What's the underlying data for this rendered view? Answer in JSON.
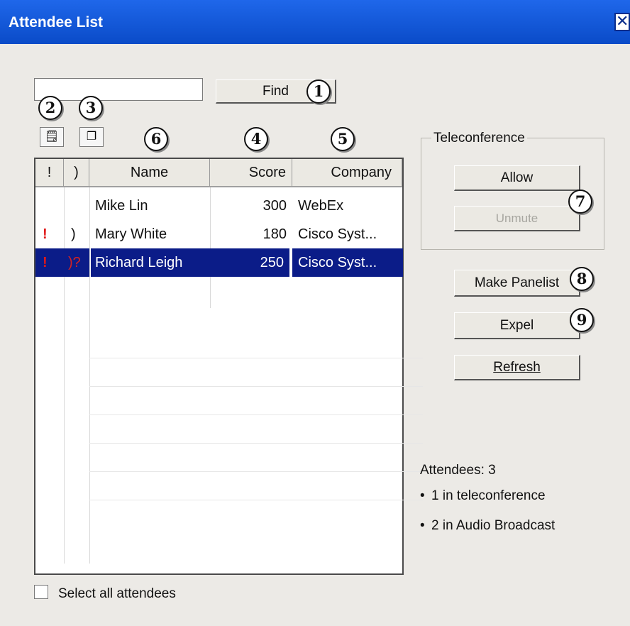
{
  "window": {
    "title": "Attendee List",
    "close_glyph": "✕"
  },
  "find": {
    "input_value": "",
    "button_label": "Find"
  },
  "toolbar": {
    "icon1": "note-icon",
    "icon2": "copy-icon"
  },
  "callouts": [
    "1",
    "2",
    "3",
    "4",
    "5",
    "6",
    "7",
    "8",
    "9"
  ],
  "table": {
    "headers": [
      "!",
      ")",
      "Name",
      "Score",
      "Company"
    ],
    "rows": [
      {
        "flag": "",
        "audio": "",
        "name": "Mike Lin",
        "score": "300",
        "company": "WebEx",
        "selected": false
      },
      {
        "flag": "!",
        "audio": ")",
        "name": "Mary White",
        "score": "180",
        "company": "Cisco Syst...",
        "selected": false
      },
      {
        "flag": "!",
        "audio": ")?",
        "name": "Richard Leigh",
        "score": "250",
        "company": "Cisco Syst...",
        "selected": true
      }
    ]
  },
  "teleconference": {
    "label": "Teleconference",
    "allow": "Allow",
    "unmute": "Unmute"
  },
  "actions": {
    "make_panelist": "Make Panelist",
    "expel": "Expel",
    "refresh": "Refresh"
  },
  "stats": {
    "attendees": "Attendees: 3",
    "line1": "1 in teleconference",
    "line2": "2 in Audio Broadcast"
  },
  "select_all": {
    "label": "Select all attendees",
    "checked": false
  },
  "colors": {
    "titlebar": "#1457d8",
    "selection": "#0b1c88",
    "alert": "#e01818"
  }
}
